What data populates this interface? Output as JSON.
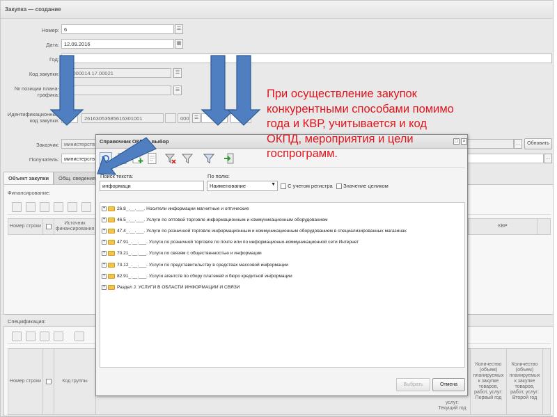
{
  "window": {
    "title": "Закупка — создание"
  },
  "form": {
    "number_label": "Номер:",
    "number_value": "6",
    "date_label": "Дата:",
    "date_value": "12.09.2016",
    "year_label": "Год:",
    "purchase_code_label": "Код закупки:",
    "purchase_code_value": "582000014.17.00021",
    "plan_position_label": "№ позиции плана-графика:",
    "ident_code_label": "Идентификационный код закупки:",
    "ident_code_year": "17",
    "ident_code_value": "26163053585616301001",
    "ident_code_part": "000",
    "customer_label": "Заказчик:",
    "customer_value": "министерств",
    "recipient_label": "Получатель:",
    "recipient_value": "министерств",
    "refresh_button": "Обновить"
  },
  "tabs": [
    "Объект закупки",
    "Общ. сведения"
  ],
  "financing": {
    "label": "Финансирование:",
    "columns": [
      "Номер строки",
      "Источник финансирования",
      "КВР"
    ]
  },
  "specification": {
    "label": "Спецификация:",
    "columns": [
      "Номер строки",
      "Код группы"
    ],
    "right_columns": [
      "услуг: Текущий год",
      "Количество (объем) планируемых к закупке товаров, работ, услуг: Первый год",
      "Количество (объем) планируемых к закупке товаров, работ, услуг: Второй год"
    ]
  },
  "dialog": {
    "title": "Справочник ОКПД - выбор",
    "search_text_label": "Поиск текста:",
    "search_text_value": "информаци",
    "by_field_label": "По полю:",
    "by_field_value": "Наименование",
    "case_sensitive_label": "С учетом регистра",
    "whole_value_label": "Значение целиком",
    "tree": [
      "26.8_.__.___. Носители информации магнитные и оптические",
      "46.5_.__.___. Услуги по оптовой торговле информационным и коммуникационным оборудованием",
      "47.4_.__.___. Услуги по розничной торговле информационным и коммуникационным оборудованием в специализированных магазинах",
      "47.91_.__.___. Услуги по розничной торговле по почте или по информационно-коммуникационной сети Интернет",
      "70.21_.__.___. Услуги по связям с общественностью и информации",
      "73.12_.__.___. Услуги по представительству в средствах массовой информации",
      "82.91_.__.___. Услуги агентств по сбору платежей и бюро кредитной информации",
      "Раздел J. УСЛУГИ В ОБЛАСТИ ИНФОРМАЦИИ И СВЯЗИ"
    ],
    "select_button": "Выбрать",
    "cancel_button": "Отмена"
  },
  "callout": "При осуществление закупок\nконкурентными способами помимо\nгода и КВР, учитывается и код\nОКПД, мероприятия и цели\nгоспрограмм.",
  "colors": {
    "arrow": "#4f7fc0",
    "arrow_border": "#2d5a95",
    "callout_text": "#e0141c"
  }
}
